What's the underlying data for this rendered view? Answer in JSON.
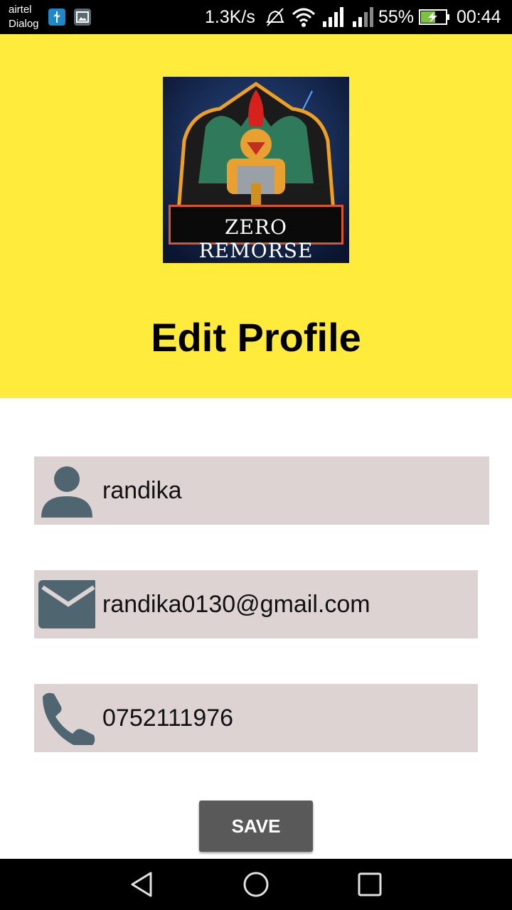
{
  "status_bar": {
    "carrier_1": "airtel",
    "carrier_2": "Dialog",
    "net_speed": "1.3K/s",
    "battery": "55%",
    "time": "00:44",
    "icons": [
      "usb-icon",
      "image-icon",
      "mute-icon",
      "wifi-icon",
      "signal-icon",
      "signal-icon",
      "battery-charging-icon"
    ]
  },
  "header": {
    "logo_text": "ZERO REMORSE",
    "title": "Edit Profile",
    "background": "#ffeb3b"
  },
  "form": {
    "name": {
      "value": "randika",
      "icon": "person-icon"
    },
    "email": {
      "value": "randika0130@gmail.com",
      "icon": "email-icon"
    },
    "phone": {
      "value": "0752111976",
      "icon": "phone-icon"
    },
    "field_background": "#ddd3d3",
    "icon_color": "#4f6670"
  },
  "actions": {
    "save_label": "SAVE"
  },
  "nav_bar": {
    "buttons": [
      "back-icon",
      "home-icon",
      "recents-icon"
    ]
  }
}
